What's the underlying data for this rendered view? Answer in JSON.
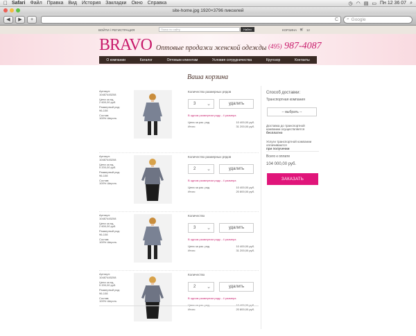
{
  "os_menu": {
    "apple": "",
    "app": "Safari",
    "items": [
      "Файл",
      "Правка",
      "Вид",
      "История",
      "Закладки",
      "Окно",
      "Справка"
    ],
    "clock": "Пн 12 36 07"
  },
  "window": {
    "title": "site-home.jpg 1920×3796 пикселей"
  },
  "browser": {
    "back": "◀",
    "forward": "▶",
    "add": "+",
    "reload": "C",
    "search_placeholder": "Google"
  },
  "topbar": {
    "login": "ВОЙТИ / РЕГИСТРАЦИЯ",
    "search_placeholder": "Поиск по сайту",
    "search_button": "Найти",
    "cart": "КОРЗИНА",
    "cart_count": "12"
  },
  "header": {
    "logo": "BRAVO",
    "tagline": "Оптовые продажи женской одежды",
    "phone_code": "(495)",
    "phone_number": "987-4087"
  },
  "nav": [
    "О компании",
    "Каталог",
    "Оптовым клиентам",
    "Условия сотрудничества",
    "Кругозор",
    "Контакты"
  ],
  "page_title": "Ваша корзина",
  "items": [
    {
      "article_label": "Артикул:",
      "article": "10487445208",
      "price_label": "Цена за ед.",
      "price": "2 600,00 руб.",
      "size_label": "Размерный ряд:",
      "size": "96-108",
      "comp_label": "Состав:",
      "comp": "100% Шерсть",
      "rows_label": "Количество размерных рядов",
      "qty": "3",
      "delete": "удалить",
      "note": "В одном размерном ряду - 4 размера",
      "row_price_label": "Цена за раз. ряд",
      "row_price": "10 400,00 руб.",
      "total_label": "Итого",
      "total": "31 200,00 руб."
    },
    {
      "article_label": "Артикул:",
      "article": "10487445208",
      "price_label": "Цена за ед.",
      "price": "5 200,00 руб.",
      "size_label": "Размерный ряд:",
      "size": "96-108",
      "comp_label": "Состав:",
      "comp": "100% Шерсть",
      "rows_label": "Количество размерных рядов",
      "qty": "2",
      "delete": "удалить",
      "note": "В одном размерном ряду - 4 размера",
      "row_price_label": "Цена за раз. ряд",
      "row_price": "10 400,00 руб.",
      "total_label": "Итого",
      "total": "20 800,00 руб."
    },
    {
      "article_label": "Артикул:",
      "article": "10487445208",
      "price_label": "Цена за ед.",
      "price": "2 600,00 руб.",
      "size_label": "Размерный ряд:",
      "size": "96-108",
      "comp_label": "Состав:",
      "comp": "100% Шерсть",
      "rows_label": "Количество",
      "qty": "3",
      "delete": "удалить",
      "note": "В одном размерном ряду - 4 размера",
      "row_price_label": "Цена за раз. ряд",
      "row_price": "10 400,00 руб.",
      "total_label": "Итого",
      "total": "31 200,00 руб."
    },
    {
      "article_label": "Артикул:",
      "article": "10487445208",
      "price_label": "Цена за ед.",
      "price": "5 200,00 руб.",
      "size_label": "Размерный ряд:",
      "size": "96-108",
      "comp_label": "Состав:",
      "comp": "100% Шерсть",
      "rows_label": "Количество",
      "qty": "2",
      "delete": "удалить",
      "note": "В одном размерном ряду - 4 размера",
      "row_price_label": "Цена за раз. ряд",
      "row_price": "10 400,00 руб.",
      "total_label": "Итого",
      "total": "20 800,00 руб."
    }
  ],
  "sidebar": {
    "delivery_title": "Способ доставки:",
    "delivery_value": "Транспортная компания",
    "select_placeholder": "-- выбрать --",
    "delivery_note": "Доставка до транспортной компании осуществляется",
    "delivery_note_bold": "бесплатно",
    "service_note": "Услуги транспортной компании оплачиваются",
    "service_note_bold": "при получении",
    "total_label": "Всего к оплате",
    "total": "104 000,00 руб.",
    "order_button": "ЗАКАЗАТЬ"
  }
}
